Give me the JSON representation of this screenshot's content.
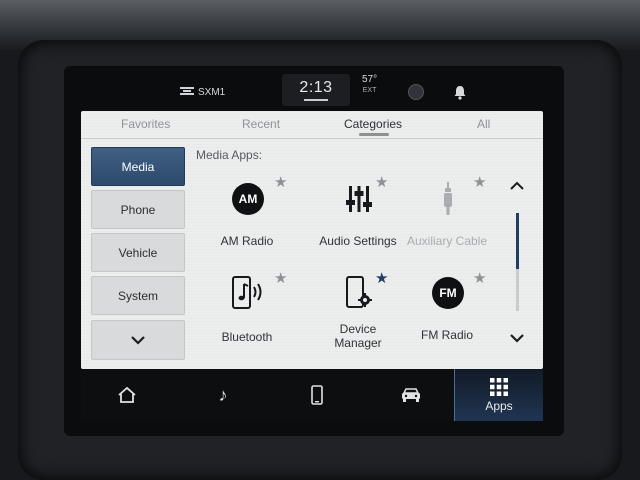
{
  "status_bar": {
    "source": "SXM1",
    "time": "2:13",
    "temperature": "57°",
    "temperature_sub": "EXT"
  },
  "tabs": [
    {
      "label": "Favorites",
      "active": false
    },
    {
      "label": "Recent",
      "active": false
    },
    {
      "label": "Categories",
      "active": true
    },
    {
      "label": "All",
      "active": false
    }
  ],
  "sidebar": {
    "items": [
      {
        "label": "Media",
        "active": true
      },
      {
        "label": "Phone",
        "active": false
      },
      {
        "label": "Vehicle",
        "active": false
      },
      {
        "label": "System",
        "active": false
      }
    ],
    "more_icon": "chevron-down-icon"
  },
  "main": {
    "heading": "Media Apps:",
    "apps": [
      {
        "label": "AM Radio",
        "badge": "AM",
        "favorite": false,
        "enabled": true,
        "icon": "am-radio-icon"
      },
      {
        "label": "Audio Settings",
        "favorite": false,
        "enabled": true,
        "icon": "equalizer-icon"
      },
      {
        "label": "Auxiliary Cable",
        "favorite": false,
        "enabled": false,
        "icon": "aux-cable-icon"
      },
      {
        "label": "Bluetooth",
        "favorite": false,
        "enabled": true,
        "icon": "bluetooth-audio-icon"
      },
      {
        "label": "Device Manager",
        "label_line1": "Device",
        "label_line2": "Manager",
        "favorite": true,
        "enabled": true,
        "icon": "device-manager-icon"
      },
      {
        "label": "FM Radio",
        "badge": "FM",
        "favorite": false,
        "enabled": true,
        "icon": "fm-radio-icon"
      }
    ],
    "star_glyph": "★"
  },
  "bottom_nav": {
    "items": [
      {
        "icon": "home-icon"
      },
      {
        "icon": "music-note-icon",
        "glyph": "♪"
      },
      {
        "icon": "phone-icon"
      },
      {
        "icon": "car-icon"
      },
      {
        "icon": "apps-grid-icon",
        "label": "Apps",
        "active": true
      }
    ]
  },
  "colors": {
    "accent": "#2c4a6e",
    "favorite_star": "#1f3e63",
    "star": "#8e9195",
    "panel_bg": "#eceded"
  }
}
